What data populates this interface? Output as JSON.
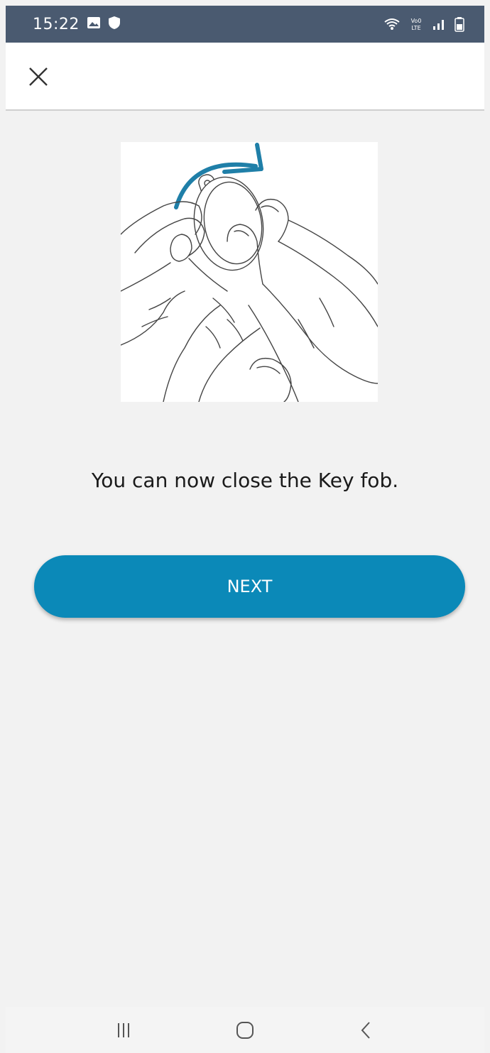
{
  "status_bar": {
    "time": "15:22",
    "left_icons": [
      "gallery-icon",
      "shield-icon"
    ],
    "right_icons": [
      "wifi-icon",
      "volte-icon",
      "signal-icon",
      "battery-icon"
    ],
    "background_color": "#4a5a70"
  },
  "header": {
    "close_icon": "close-icon"
  },
  "content": {
    "illustration": "hand-closing-key-fob-illustration",
    "message": "You can now close the Key fob."
  },
  "actions": {
    "next_label": "NEXT",
    "accent_color": "#0b89b8"
  },
  "nav_bar": {
    "items": [
      "recent-apps-icon",
      "home-icon",
      "back-icon"
    ]
  }
}
